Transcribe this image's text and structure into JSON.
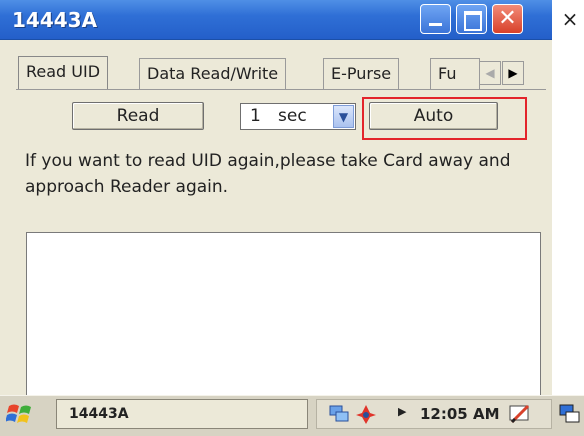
{
  "window": {
    "title": "14443A",
    "side_close": "×"
  },
  "tabs": [
    {
      "label": "Read UID",
      "active": true
    },
    {
      "label": "Data Read/Write",
      "active": false
    },
    {
      "label": "E-Purse",
      "active": false
    },
    {
      "label": "Fu",
      "active": false
    }
  ],
  "tab_scroll": {
    "left": "◀",
    "right": "▶"
  },
  "controls": {
    "read_label": "Read",
    "interval_value": "1",
    "interval_unit": "sec",
    "auto_label": "Auto"
  },
  "info_text": "If you want to read UID again,please take Card away and approach Reader again.",
  "taskbar": {
    "task_label": "14443A",
    "clock": "12:05 AM"
  },
  "colors": {
    "titlebar": "#2f6fd6",
    "highlight": "#e3242b",
    "window_bg": "#ece9d8"
  },
  "icons": [
    "minimize-icon",
    "maximize-icon",
    "close-icon",
    "start-flag-icon",
    "network-icon",
    "sync-icon",
    "pen-icon",
    "desktop-icon"
  ]
}
